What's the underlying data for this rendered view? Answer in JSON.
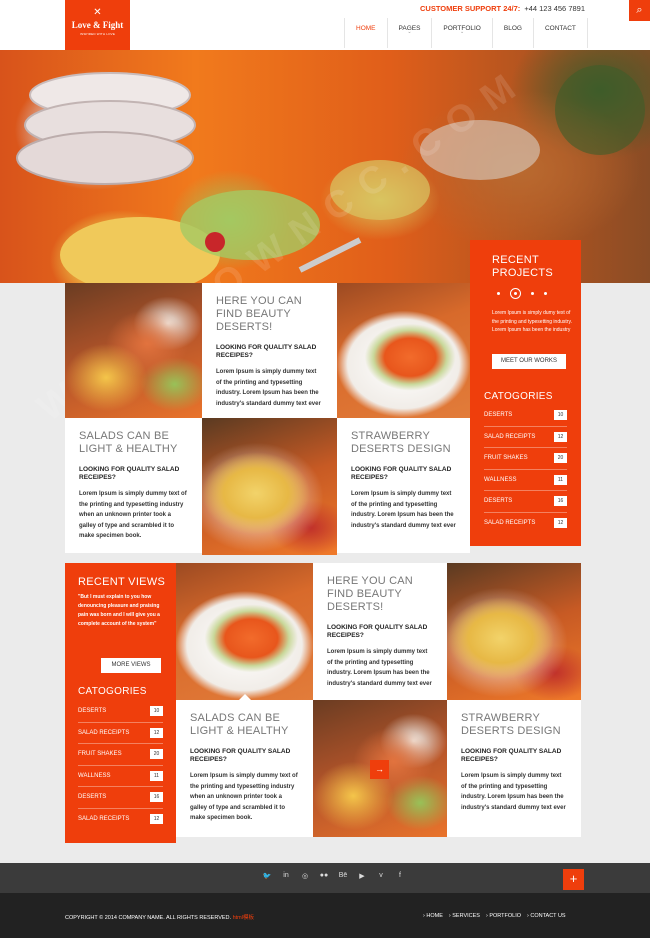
{
  "header": {
    "logo": {
      "name": "Love & Fight",
      "tagline": "INSPIRED WITH LOVE",
      "icon": "fork-knife-icon"
    },
    "support_label": "CUSTOMER SUPPORT 24/7:",
    "support_phone": "+44 123 456 7891",
    "search_icon": "search-icon",
    "nav": [
      {
        "label": "HOME",
        "active": true
      },
      {
        "label": "PAGES",
        "dropdown": true
      },
      {
        "label": "PORTFOLIO",
        "dropdown": true
      },
      {
        "label": "BLOG"
      },
      {
        "label": "CONTACT"
      }
    ]
  },
  "watermark": "WWW.DOWNCC.COM",
  "recent_projects": {
    "title_line1": "RECENT",
    "title_line2": "PROJECTS",
    "text": "Lorem Ipsum is simply dumy text of the printing and typesetting industry. Lorem Ipsum has been the industry",
    "button": "MEET OUR WORKS"
  },
  "categories_right": {
    "title": "CATOGORIES",
    "items": [
      {
        "label": "DESERTS",
        "count": "10"
      },
      {
        "label": "SALAD RECEIPTS",
        "count": "12"
      },
      {
        "label": "FRUIT SHAKES",
        "count": "20"
      },
      {
        "label": "WALLNESS",
        "count": "11"
      },
      {
        "label": "DESERTS",
        "count": "16"
      },
      {
        "label": "SALAD RECEIPTS",
        "count": "12"
      }
    ]
  },
  "tiles": {
    "beauty_1": {
      "title1": "HERE YOU CAN",
      "title2": "FIND BEAUTY",
      "title3": "DESERTS!",
      "sub": "LOOKING FOR QUALITY SALAD RECEIPES?",
      "text": "Lorem Ipsum is simply dummy text of the printing and typesetting industry. Lorem Ipsum has been the industry's standard dummy text ever"
    },
    "salads_1": {
      "title1": "SALADS CAN BE",
      "title2": "LIGHT & HEALTHY",
      "sub": "LOOKING FOR QUALITY SALAD RECEIPES?",
      "text": "Lorem Ipsum is simply dummy text of the printing and typesetting industry when an unknown printer took a galley of type and scrambled it to make specimen book."
    },
    "straw_1": {
      "title1": "STRAWBERRY",
      "title2": "DESERTS DESIGN",
      "sub": "LOOKING FOR QUALITY SALAD RECEIPES?",
      "text": "Lorem Ipsum is simply dummy text of the printing and typesetting industry. Lorem Ipsum has been the industry's standard dummy text ever"
    },
    "beauty_2": {
      "title1": "HERE YOU CAN",
      "title2": "FIND BEAUTY",
      "title3": "DESERTS!",
      "sub": "LOOKING FOR QUALITY SALAD RECEIPES?",
      "text": "Lorem Ipsum is simply dummy text of the printing and typesetting industry. Lorem Ipsum has been the industry's standard dummy text ever"
    },
    "salads_2": {
      "title1": "SALADS CAN BE",
      "title2": "LIGHT & HEALTHY",
      "sub": "LOOKING FOR QUALITY SALAD RECEIPES?",
      "text": "Lorem Ipsum is simply dummy text of the printing and typesetting industry when an unknown printer took a galley of type and scrambled it to make specimen book."
    },
    "straw_2": {
      "title1": "STRAWBERRY",
      "title2": "DESERTS DESIGN",
      "sub": "LOOKING FOR QUALITY SALAD RECEIPES?",
      "text": "Lorem Ipsum is simply dummy text of the printing and typesetting industry. Lorem Ipsum has been the industry's standard dummy text ever"
    }
  },
  "recent_views": {
    "title": "RECENT VIEWS",
    "quote": "\"But I must explain to you how denouncing pleasure and praising pain was born and I will give you a complete account of the system\"",
    "button": "MORE VIEWS"
  },
  "categories_left": {
    "title": "CATOGORIES",
    "items": [
      {
        "label": "DESERTS",
        "count": "10"
      },
      {
        "label": "SALAD RECEIPTS",
        "count": "12"
      },
      {
        "label": "FRUIT SHAKES",
        "count": "20"
      },
      {
        "label": "WALLNESS",
        "count": "11"
      },
      {
        "label": "DESERTS",
        "count": "16"
      },
      {
        "label": "SALAD RECEIPTS",
        "count": "12"
      }
    ]
  },
  "footer": {
    "social": [
      {
        "icon": "twitter-icon",
        "glyph": "🐦"
      },
      {
        "icon": "linkedin-icon",
        "glyph": "in"
      },
      {
        "icon": "dribbble-icon",
        "glyph": "◎"
      },
      {
        "icon": "flickr-icon",
        "glyph": "●●"
      },
      {
        "icon": "behance-icon",
        "glyph": "Bē"
      },
      {
        "icon": "youtube-icon",
        "glyph": "▶"
      },
      {
        "icon": "vimeo-icon",
        "glyph": "v"
      },
      {
        "icon": "facebook-icon",
        "glyph": "f"
      }
    ],
    "plus": "+",
    "copyright": "COPYRIGHT © 2014 COMPANY NAME. ALL RIGHTS RESERVED.",
    "copyright_cn": "html模板",
    "nav": [
      "› HOME",
      "› SERVICES",
      "› PORTFOLIO",
      "› CONTACT US"
    ]
  },
  "colors": {
    "accent": "#ef3e0c",
    "dark": "#222222",
    "footer_top": "#3b3b3b",
    "page_bg": "#ebebeb"
  }
}
